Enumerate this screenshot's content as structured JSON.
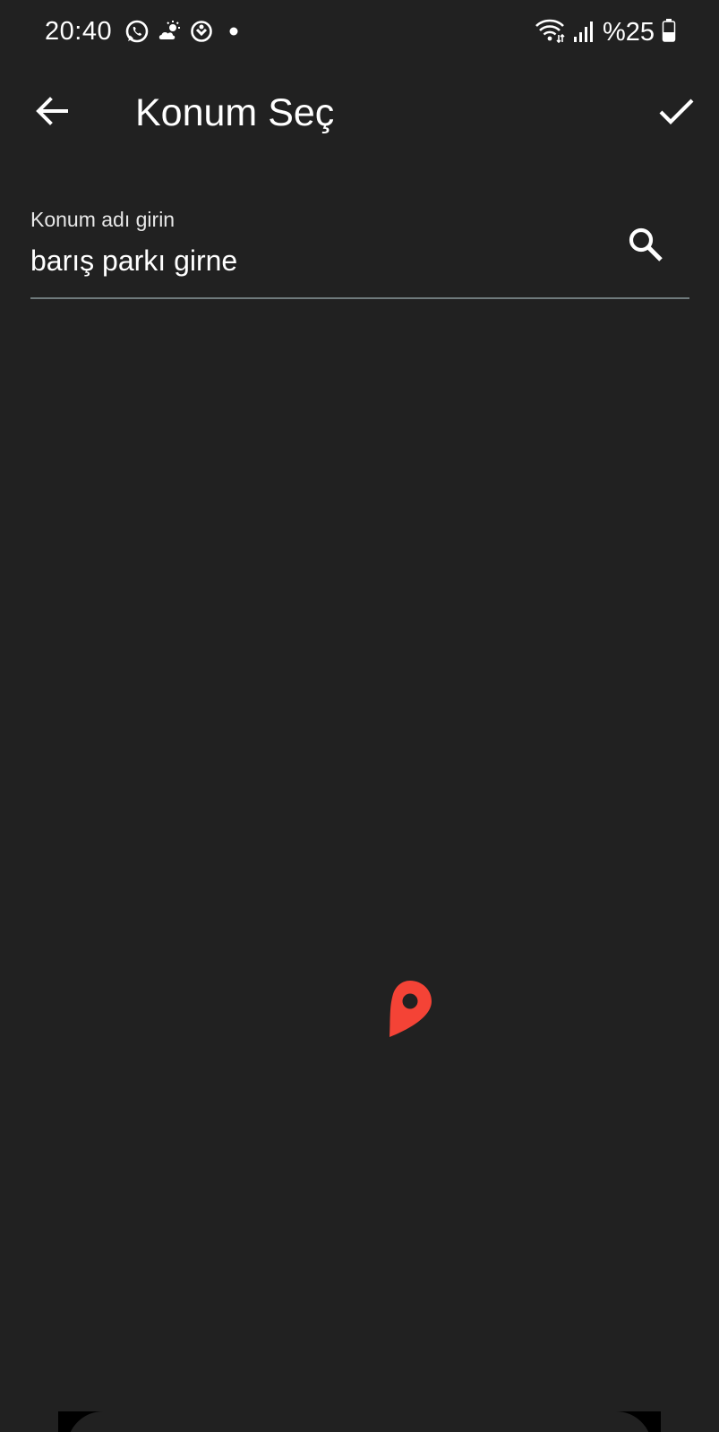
{
  "status_bar": {
    "time": "20:40",
    "battery_text": "%25",
    "icons_left": [
      "whatsapp-icon",
      "weather-icon",
      "sync-icon",
      "notification-dot-icon"
    ],
    "icons_right": [
      "wifi-icon",
      "signal-icon",
      "battery-icon"
    ]
  },
  "app_bar": {
    "title": "Konum Seç",
    "back_icon": "arrow-back-icon",
    "confirm_icon": "check-icon"
  },
  "search": {
    "label": "Konum adı girin",
    "value": "barış parkı girne",
    "icon": "search-icon"
  },
  "map": {
    "pin_icon": "map-pin-icon"
  },
  "colors": {
    "background": "#212121",
    "pin": "#f44336",
    "underline": "#6f7a7c",
    "text": "#ffffff"
  }
}
